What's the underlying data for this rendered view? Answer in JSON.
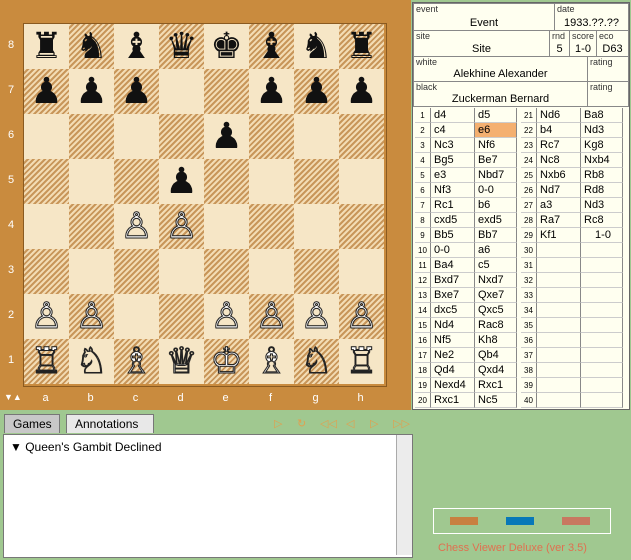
{
  "board": {
    "files": [
      "a",
      "b",
      "c",
      "d",
      "e",
      "f",
      "g",
      "h"
    ],
    "ranks": [
      "8",
      "7",
      "6",
      "5",
      "4",
      "3",
      "2",
      "1"
    ],
    "flip_label": "▼▲",
    "position": [
      [
        "♜",
        "♞",
        "♝",
        "♛",
        "♚",
        "♝",
        "♞",
        "♜"
      ],
      [
        "♟",
        "♟",
        "♟",
        "",
        "",
        "♟",
        "♟",
        "♟"
      ],
      [
        "",
        "",
        "",
        "",
        "♟",
        "",
        "",
        ""
      ],
      [
        "",
        "",
        "",
        "♟",
        "",
        "",
        "",
        ""
      ],
      [
        "",
        "",
        "♙",
        "♙",
        "",
        "",
        "",
        ""
      ],
      [
        "",
        "",
        "",
        "",
        "",
        "",
        "",
        ""
      ],
      [
        "♙",
        "♙",
        "",
        "",
        "♙",
        "♙",
        "♙",
        "♙"
      ],
      [
        "♖",
        "♘",
        "♗",
        "♕",
        "♔",
        "♗",
        "♘",
        "♖"
      ]
    ]
  },
  "game": {
    "event_label": "event",
    "event": "Event",
    "date_label": "date",
    "date": "1933.??.??",
    "site_label": "site",
    "site": "Site",
    "rnd_label": "rnd",
    "rnd": "5",
    "score_label": "score",
    "score": "1-0",
    "eco_label": "eco",
    "eco": "D63",
    "white_label": "white",
    "white": "Alekhine Alexander",
    "rating_label": "rating",
    "black_label": "black",
    "black": "Zuckerman Bernard"
  },
  "moves_left": [
    [
      "1",
      "d4",
      "d5"
    ],
    [
      "2",
      "c4",
      "e6"
    ],
    [
      "3",
      "Nc3",
      "Nf6"
    ],
    [
      "4",
      "Bg5",
      "Be7"
    ],
    [
      "5",
      "e3",
      "Nbd7"
    ],
    [
      "6",
      "Nf3",
      "0-0"
    ],
    [
      "7",
      "Rc1",
      "b6"
    ],
    [
      "8",
      "cxd5",
      "exd5"
    ],
    [
      "9",
      "Bb5",
      "Bb7"
    ],
    [
      "10",
      "0-0",
      "a6"
    ],
    [
      "11",
      "Ba4",
      "c5"
    ],
    [
      "12",
      "Bxd7",
      "Nxd7"
    ],
    [
      "13",
      "Bxe7",
      "Qxe7"
    ],
    [
      "14",
      "dxc5",
      "Qxc5"
    ],
    [
      "15",
      "Nd4",
      "Rac8"
    ],
    [
      "16",
      "Nf5",
      "Kh8"
    ],
    [
      "17",
      "Ne2",
      "Qb4"
    ],
    [
      "18",
      "Qd4",
      "Qxd4"
    ],
    [
      "19",
      "Nexd4",
      "Rxc1"
    ],
    [
      "20",
      "Rxc1",
      "Nc5"
    ]
  ],
  "moves_right": [
    [
      "21",
      "Nd6",
      "Ba8"
    ],
    [
      "22",
      "b4",
      "Nd3"
    ],
    [
      "23",
      "Rc7",
      "Kg8"
    ],
    [
      "24",
      "Nc8",
      "Nxb4"
    ],
    [
      "25",
      "Nxb6",
      "Rb8"
    ],
    [
      "26",
      "Nd7",
      "Rd8"
    ],
    [
      "27",
      "a3",
      "Nd3"
    ],
    [
      "28",
      "Ra7",
      "Rc8"
    ],
    [
      "29",
      "Kf1",
      "1-0"
    ],
    [
      "30",
      "",
      ""
    ],
    [
      "31",
      "",
      ""
    ],
    [
      "32",
      "",
      ""
    ],
    [
      "33",
      "",
      ""
    ],
    [
      "34",
      "",
      ""
    ],
    [
      "35",
      "",
      ""
    ],
    [
      "36",
      "",
      ""
    ],
    [
      "37",
      "",
      ""
    ],
    [
      "38",
      "",
      ""
    ],
    [
      "39",
      "",
      ""
    ],
    [
      "40",
      "",
      ""
    ]
  ],
  "tabs": {
    "games": "Games",
    "annotations": "Annotations"
  },
  "nav": {
    "play": "▷",
    "loop": "↻",
    "first": "◁◁",
    "prev": "◁",
    "next": "▷",
    "last": "▷▷"
  },
  "annotation_text": "▼ Queen's Gambit Declined",
  "legend_colors": [
    "#c88040",
    "#0878b8",
    "#c87860"
  ],
  "footer": "Chess Viewer Deluxe (ver 3.5)"
}
